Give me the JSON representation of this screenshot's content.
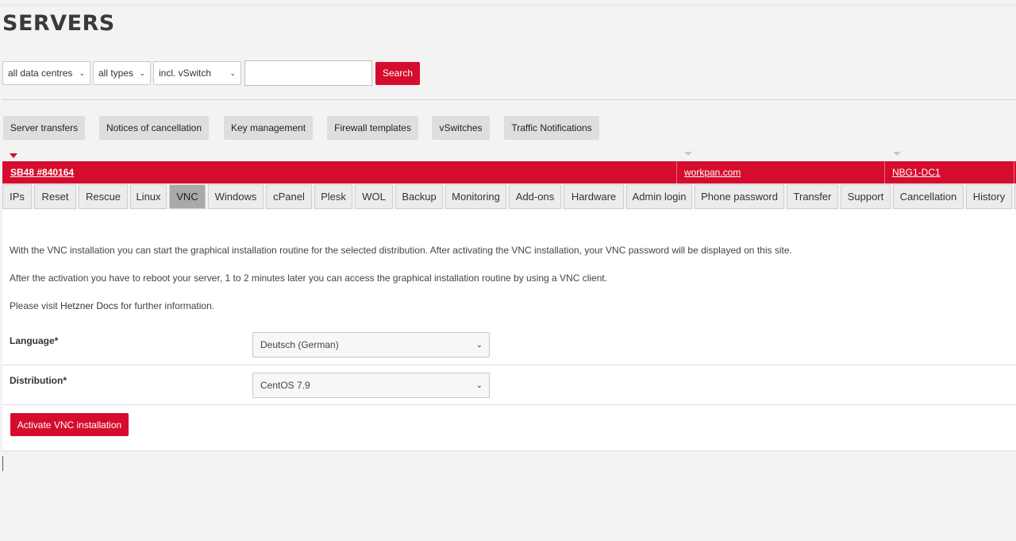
{
  "page": {
    "title": "SERVERS"
  },
  "filters": {
    "datacenter": "all data centres",
    "type": "all types",
    "vswitch": "incl. vSwitch",
    "search_value": "",
    "search_button": "Search"
  },
  "actions": [
    "Server transfers",
    "Notices of cancellation",
    "Key management",
    "Firewall templates",
    "vSwitches",
    "Traffic Notifications"
  ],
  "server": {
    "name": "SB48 #840164",
    "hostname": "workpan.com",
    "datacenter": "NBG1-DC1"
  },
  "tabs": [
    "IPs",
    "Reset",
    "Rescue",
    "Linux",
    "VNC",
    "Windows",
    "cPanel",
    "Plesk",
    "WOL",
    "Backup",
    "Monitoring",
    "Add-ons",
    "Hardware",
    "Admin login",
    "Phone password",
    "Transfer",
    "Support",
    "Cancellation",
    "History"
  ],
  "active_tab": "VNC",
  "vnc": {
    "intro": "With the VNC installation you can start the graphical installation routine for the selected distribution. After activating the VNC installation, your VNC password will be displayed on this site.",
    "reboot_note": "After the activation you have to reboot your server, 1 to 2 minutes later you can access the graphical installation routine by using a VNC client.",
    "docs_prefix": "Please visit ",
    "docs_link": "Hetzner Docs",
    "docs_suffix": " for further information.",
    "language_label": "Language*",
    "language_value": "Deutsch (German)",
    "distribution_label": "Distribution*",
    "distribution_value": "CentOS 7.9",
    "activate_button": "Activate VNC installation"
  },
  "colors": {
    "accent": "#d50c2d",
    "background": "#f3f3f3",
    "active_tab": "#a9a9a9"
  },
  "icons": {
    "select_arrow": "chevron-down-icon",
    "marker": "triangle-down-icon"
  }
}
